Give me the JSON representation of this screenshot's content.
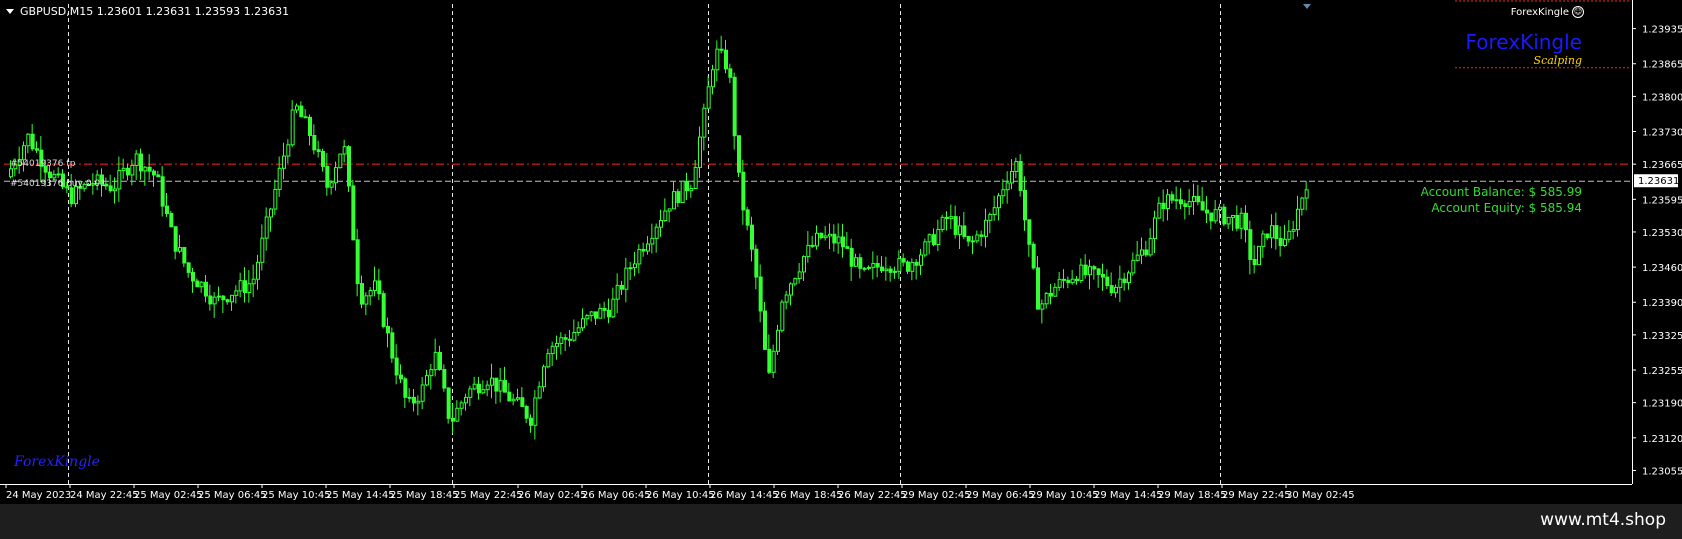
{
  "header": {
    "symbol_info": "GBPUSD,M15  1.23601 1.23631 1.23593 1.23631"
  },
  "expert": {
    "name": "ForexKingle",
    "smile_glyph": "☺"
  },
  "brand": {
    "title": "ForexKingle",
    "subtitle": "Scalping",
    "bottom_logo": "ForexKingle"
  },
  "account": {
    "balance": "Account Balance: $ 585.99",
    "equity": "Account Equity: $ 585.94"
  },
  "orders": {
    "tp_label": "#54019376 tp",
    "open_label": "#54019376 buy 0.01"
  },
  "watermark": "www.mt4.shop",
  "colors": {
    "background": "#000000",
    "candle": "#33ff33",
    "grid": "#ffffff",
    "tp_line": "#ff2222",
    "bid_line": "#c0c0c0",
    "account_text": "#33dd33",
    "brand_blue": "#1a1aff",
    "brand_yellow": "#ffd700"
  },
  "chart_data": {
    "type": "candlestick",
    "symbol": "GBPUSD",
    "timeframe": "M15",
    "ylim": [
      1.23028,
      1.23984
    ],
    "price_ticks": [
      "1.23935",
      "1.23865",
      "1.23800",
      "1.23730",
      "1.23665",
      "1.23595",
      "1.23530",
      "1.23460",
      "1.23390",
      "1.23325",
      "1.23255",
      "1.23190",
      "1.23120",
      "1.23055"
    ],
    "time_ticks": [
      "24 May 2023",
      "24 May 22:45",
      "25 May 02:45",
      "25 May 06:45",
      "25 May 10:45",
      "25 May 14:45",
      "25 May 18:45",
      "25 May 22:45",
      "26 May 02:45",
      "26 May 06:45",
      "26 May 10:45",
      "26 May 14:45",
      "26 May 18:45",
      "26 May 22:45",
      "29 May 02:45",
      "29 May 06:45",
      "29 May 10:45",
      "29 May 14:45",
      "29 May 18:45",
      "29 May 22:45",
      "30 May 02:45"
    ],
    "current_price": "1.23631",
    "tp_price": 1.23665,
    "open_price": 1.23631,
    "levels": [
      1.2399,
      1.23857
    ],
    "vertical_grid_at": [
      "24 May 22:45",
      "25 May 22:45",
      "26 May 14:45",
      "29 May 02:45",
      "29 May 22:45"
    ],
    "price_path": [
      [
        0,
        1.2364
      ],
      [
        20,
        1.2372
      ],
      [
        40,
        1.2365
      ],
      [
        60,
        1.236
      ],
      [
        80,
        1.2363
      ],
      [
        100,
        1.2362
      ],
      [
        120,
        1.2368
      ],
      [
        140,
        1.2364
      ],
      [
        155,
        1.2352
      ],
      [
        170,
        1.2345
      ],
      [
        185,
        1.2342
      ],
      [
        195,
        1.2339
      ],
      [
        210,
        1.2341
      ],
      [
        230,
        1.2343
      ],
      [
        245,
        1.2356
      ],
      [
        260,
        1.2369
      ],
      [
        270,
        1.2378
      ],
      [
        285,
        1.2372
      ],
      [
        300,
        1.2362
      ],
      [
        315,
        1.2371
      ],
      [
        330,
        1.234
      ],
      [
        345,
        1.2342
      ],
      [
        360,
        1.2329
      ],
      [
        375,
        1.2318
      ],
      [
        390,
        1.2322
      ],
      [
        400,
        1.2329
      ],
      [
        415,
        1.2315
      ],
      [
        430,
        1.2321
      ],
      [
        450,
        1.2324
      ],
      [
        470,
        1.232
      ],
      [
        490,
        1.2316
      ],
      [
        505,
        1.233
      ],
      [
        525,
        1.2332
      ],
      [
        545,
        1.2336
      ],
      [
        565,
        1.2338
      ],
      [
        585,
        1.2347
      ],
      [
        605,
        1.2354
      ],
      [
        620,
        1.2359
      ],
      [
        640,
        1.2363
      ],
      [
        652,
        1.2376
      ],
      [
        662,
        1.2389
      ],
      [
        675,
        1.2386
      ],
      [
        685,
        1.2362
      ],
      [
        700,
        1.2345
      ],
      [
        712,
        1.2323
      ],
      [
        725,
        1.234
      ],
      [
        745,
        1.2348
      ],
      [
        760,
        1.2352
      ],
      [
        780,
        1.2351
      ],
      [
        800,
        1.2344
      ],
      [
        820,
        1.2347
      ],
      [
        840,
        1.2346
      ],
      [
        860,
        1.235
      ],
      [
        880,
        1.2356
      ],
      [
        900,
        1.235
      ],
      [
        920,
        1.2356
      ],
      [
        935,
        1.2364
      ],
      [
        945,
        1.2367
      ],
      [
        955,
        1.235
      ],
      [
        965,
        1.2338
      ],
      [
        980,
        1.2342
      ],
      [
        1000,
        1.2345
      ],
      [
        1020,
        1.2344
      ],
      [
        1035,
        1.2342
      ],
      [
        1050,
        1.2346
      ],
      [
        1065,
        1.235
      ],
      [
        1080,
        1.2359
      ],
      [
        1100,
        1.236
      ],
      [
        1120,
        1.2357
      ],
      [
        1140,
        1.2356
      ],
      [
        1155,
        1.2355
      ],
      [
        1165,
        1.2346
      ],
      [
        1180,
        1.2354
      ],
      [
        1195,
        1.235
      ],
      [
        1205,
        1.2356
      ],
      [
        1215,
        1.23631
      ]
    ]
  }
}
